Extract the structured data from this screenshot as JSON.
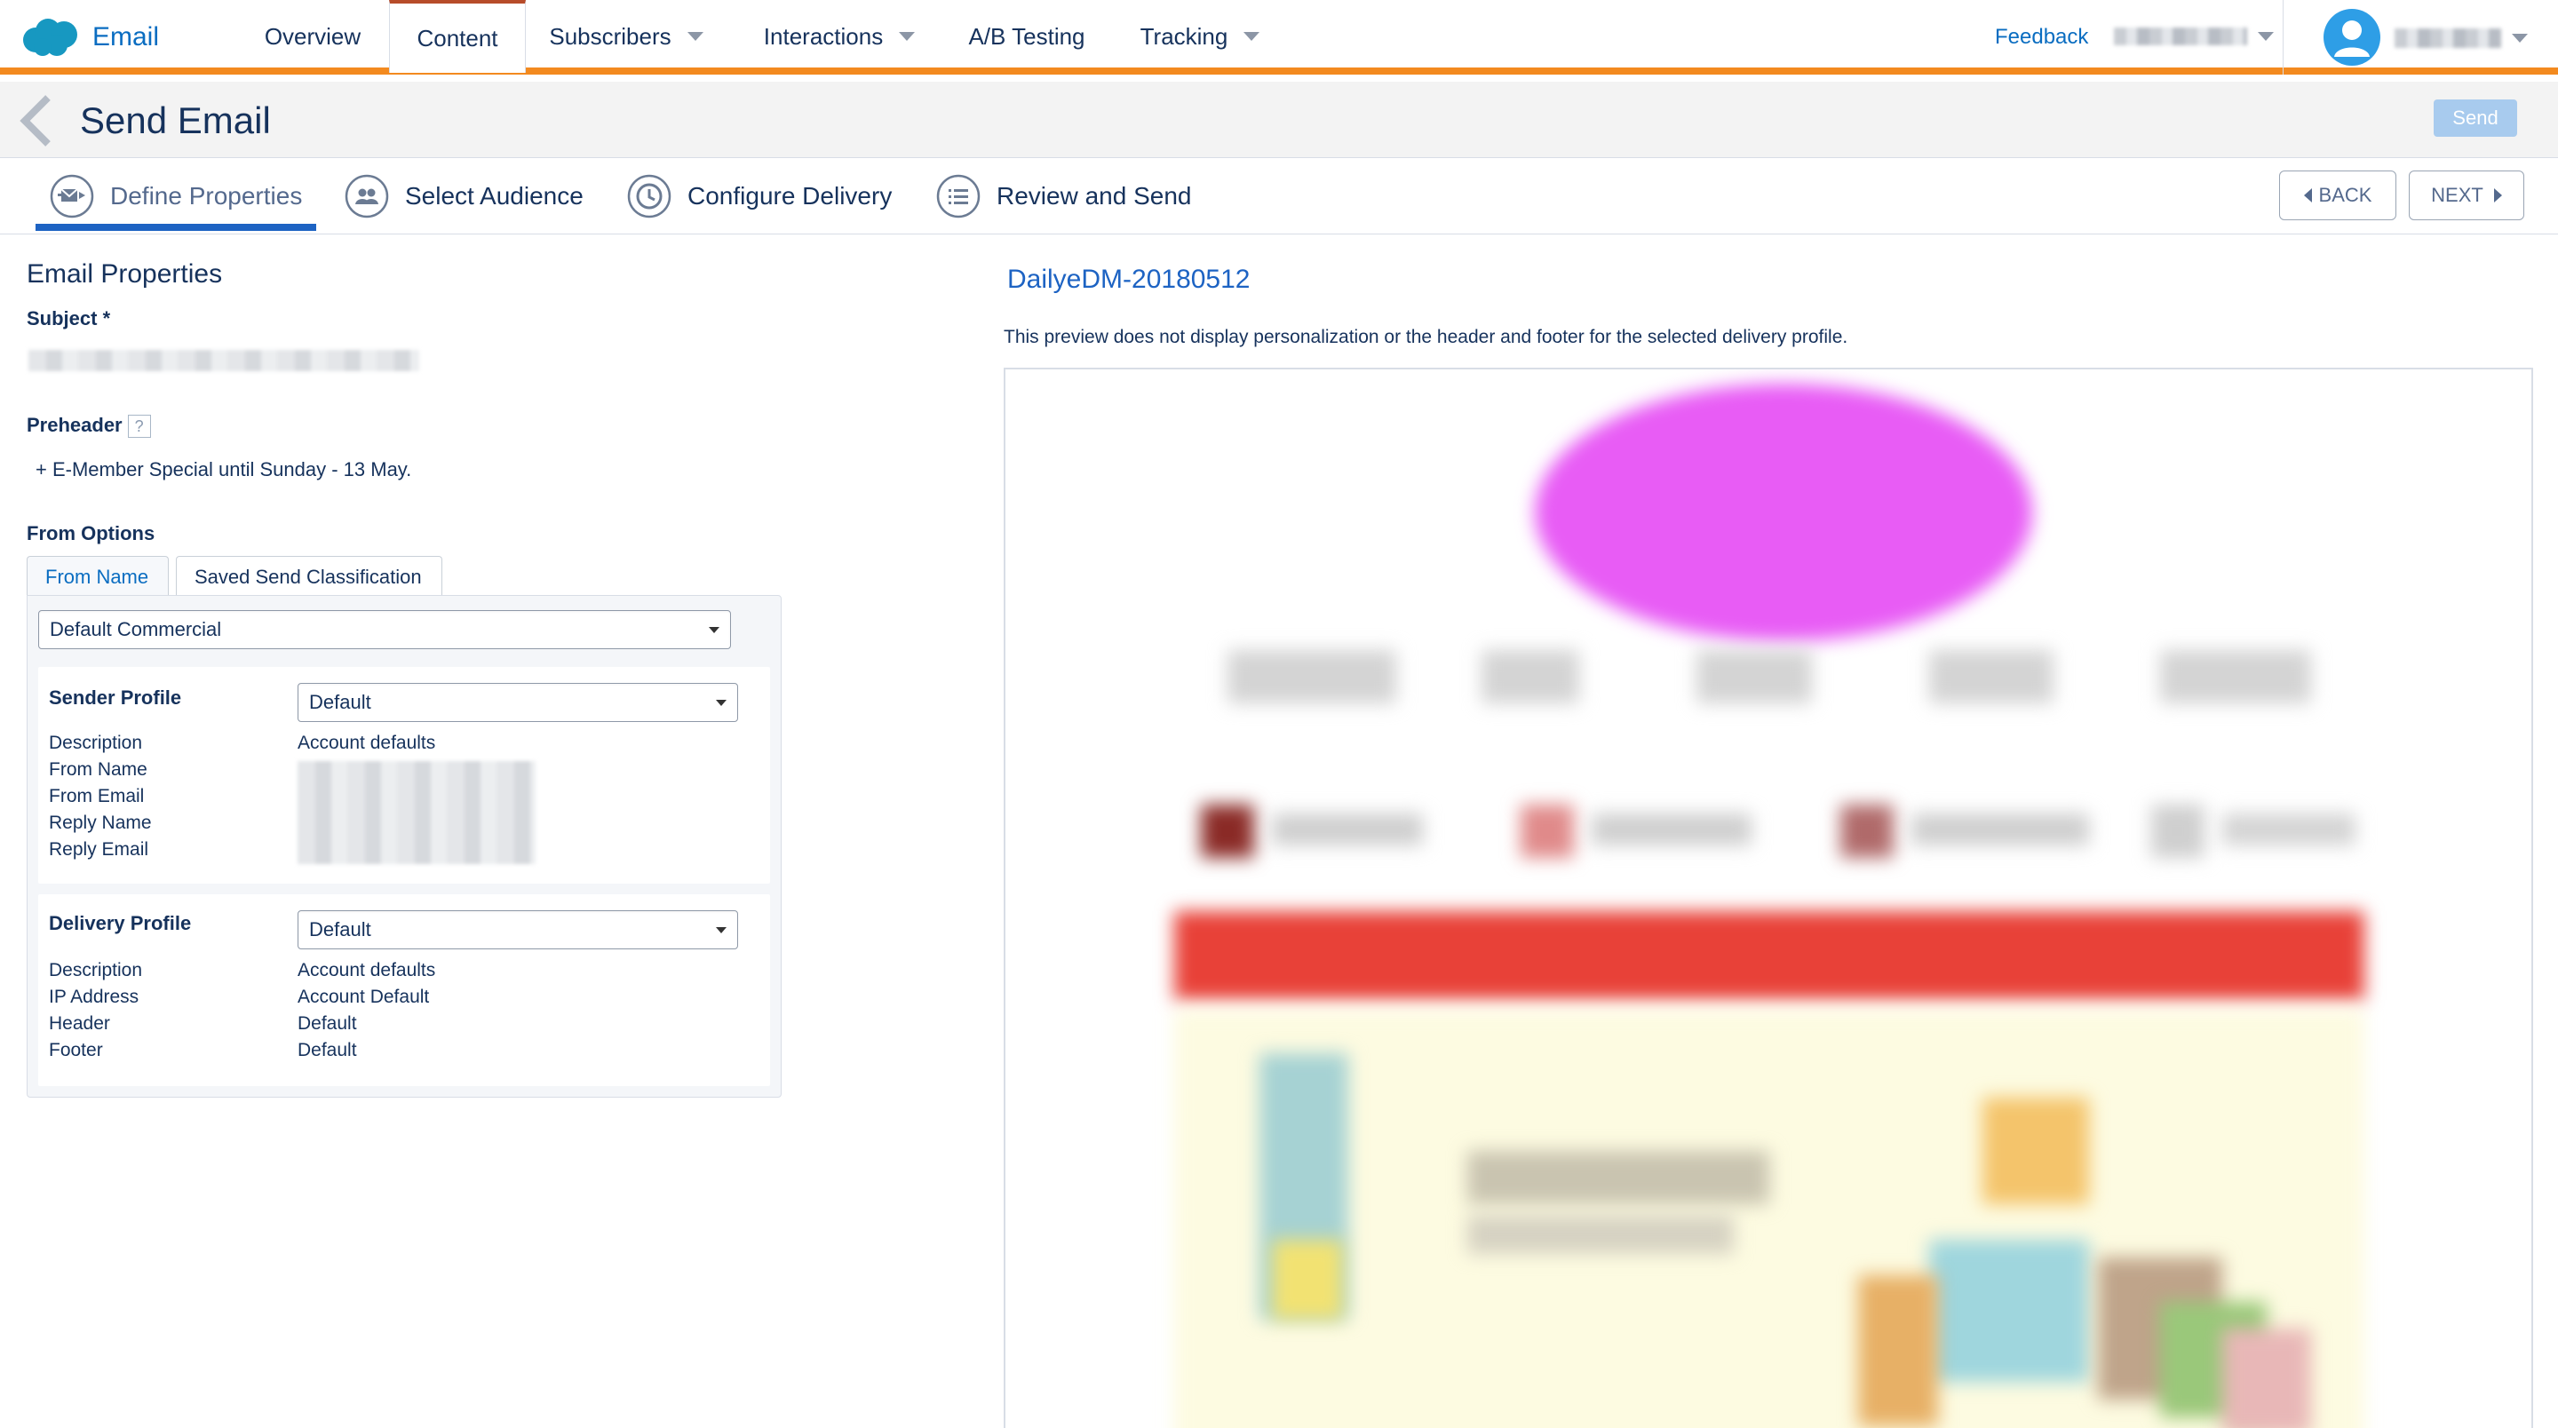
{
  "app": {
    "name": "Email"
  },
  "nav": {
    "tabs": [
      {
        "label": "Overview",
        "has_menu": false
      },
      {
        "label": "Content",
        "has_menu": false,
        "active": true
      },
      {
        "label": "Subscribers",
        "has_menu": true
      },
      {
        "label": "Interactions",
        "has_menu": true
      },
      {
        "label": "A/B Testing",
        "has_menu": false
      },
      {
        "label": "Tracking",
        "has_menu": true
      }
    ],
    "feedback": "Feedback",
    "accent_color": "#f38a1f"
  },
  "page": {
    "title": "Send Email",
    "send_label": "Send"
  },
  "steps": {
    "items": [
      {
        "label": "Define Properties",
        "icon": "envelope-send-icon",
        "active": true
      },
      {
        "label": "Select Audience",
        "icon": "audience-icon"
      },
      {
        "label": "Configure Delivery",
        "icon": "clock-icon"
      },
      {
        "label": "Review and Send",
        "icon": "list-icon"
      }
    ],
    "back_label": "BACK",
    "next_label": "NEXT"
  },
  "properties": {
    "section_title": "Email Properties",
    "subject_label": "Subject *",
    "preheader_label": "Preheader",
    "preheader_help": "?",
    "preheader_value": "+ E-Member Special until Sunday - 13 May.",
    "from_options_label": "From Options",
    "tabs": {
      "from_name": "From Name",
      "saved_send": "Saved Send Classification"
    },
    "classification": "Default Commercial",
    "sender_profile": {
      "label": "Sender Profile",
      "value": "Default",
      "rows": [
        {
          "key": "Description",
          "value": "Account defaults"
        },
        {
          "key": "From Name",
          "value": ""
        },
        {
          "key": "From Email",
          "value": ""
        },
        {
          "key": "Reply Name",
          "value": ""
        },
        {
          "key": "Reply Email",
          "value": ""
        }
      ]
    },
    "delivery_profile": {
      "label": "Delivery Profile",
      "value": "Default",
      "rows": [
        {
          "key": "Description",
          "value": "Account defaults"
        },
        {
          "key": "IP Address",
          "value": "Account Default"
        },
        {
          "key": "Header",
          "value": "Default"
        },
        {
          "key": "Footer",
          "value": "Default"
        }
      ]
    }
  },
  "preview": {
    "title": "DailyeDM-20180512",
    "note": "This preview does not display personalization or the header and footer for the selected delivery profile."
  }
}
